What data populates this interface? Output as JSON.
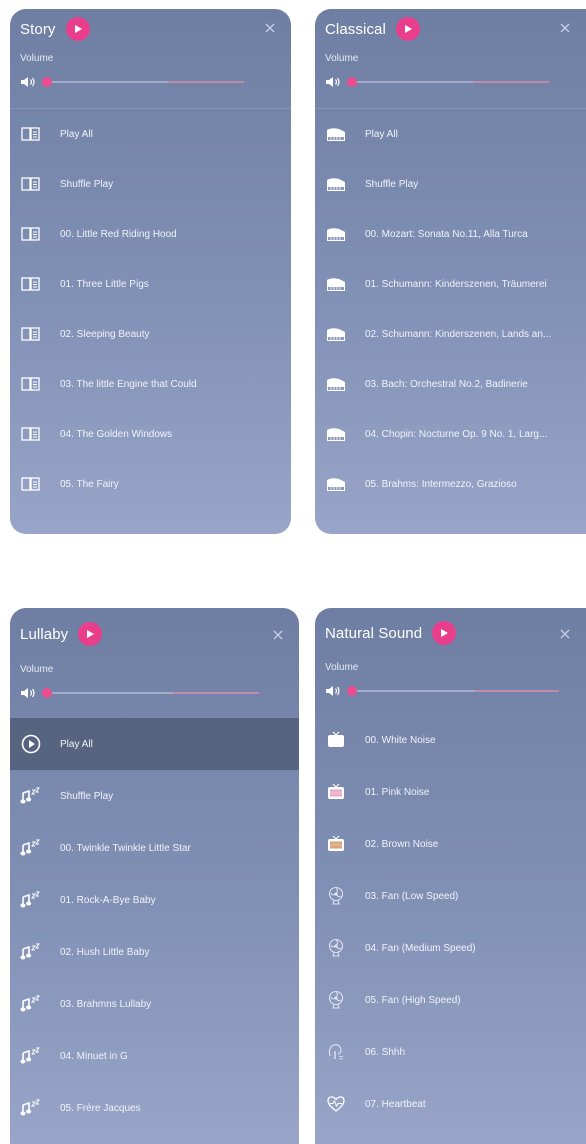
{
  "panels": {
    "story": {
      "title": "Story",
      "volume_label": "Volume",
      "volume_level": 0.62,
      "icon": "book-icon",
      "items": [
        {
          "label": "Play All"
        },
        {
          "label": "Shuffle Play"
        },
        {
          "label": "00. Little Red Riding Hood"
        },
        {
          "label": "01. Three Little Pigs"
        },
        {
          "label": "02. Sleeping Beauty"
        },
        {
          "label": "03. The little Engine that Could"
        },
        {
          "label": "04. The Golden Windows"
        },
        {
          "label": "05. The Fairy"
        }
      ]
    },
    "classical": {
      "title": "Classical",
      "volume_label": "Volume",
      "volume_level": 0.62,
      "icon": "piano-icon",
      "items": [
        {
          "label": "Play All"
        },
        {
          "label": "Shuffle Play"
        },
        {
          "label": "00. Mozart: Sonata No.11, Alla Turca"
        },
        {
          "label": "01. Schumann: Kinderszenen, Träumerei"
        },
        {
          "label": "02. Schumann: Kinderszenen, Lands an..."
        },
        {
          "label": "03. Bach: Orchestral No.2, Badinerie"
        },
        {
          "label": "04. Chopin: Nocturne Op. 9 No. 1, Larg..."
        },
        {
          "label": "05. Brahms: Intermezzo, Grazioso"
        }
      ]
    },
    "lullaby": {
      "title": "Lullaby",
      "volume_label": "Volume",
      "volume_level": 0.6,
      "icon": "music-sleep-icon",
      "items": [
        {
          "label": "Play All",
          "active": true
        },
        {
          "label": "Shuffle Play"
        },
        {
          "label": "00. Twinkle Twinkle Little Star"
        },
        {
          "label": "01. Rock-A-Bye Baby"
        },
        {
          "label": "02. Hush Little Baby"
        },
        {
          "label": "03. Brahmns Lullaby"
        },
        {
          "label": "04. Minuet in G"
        },
        {
          "label": "05. Frère Jacques"
        }
      ]
    },
    "natural": {
      "title": "Natural Sound",
      "volume_label": "Volume",
      "volume_level": 0.6,
      "items": [
        {
          "label": "00. White Noise",
          "icon": "tv-icon"
        },
        {
          "label": "01. Pink Noise",
          "icon": "tv-pink-icon"
        },
        {
          "label": "02. Brown Noise",
          "icon": "tv-brown-icon"
        },
        {
          "label": "03. Fan (Low Speed)",
          "icon": "fan-icon"
        },
        {
          "label": "04. Fan (Medium Speed)",
          "icon": "fan-icon"
        },
        {
          "label": "05. Fan (High Speed)",
          "icon": "fan-icon"
        },
        {
          "label": "06. Shhh",
          "icon": "shush-icon"
        },
        {
          "label": "07. Heartbeat",
          "icon": "heartbeat-icon"
        }
      ]
    }
  },
  "colors": {
    "accent": "#e83e8c",
    "panel_top": "#6f7ea3",
    "panel_bottom": "#98a5c8",
    "active_row": "#56647f"
  }
}
